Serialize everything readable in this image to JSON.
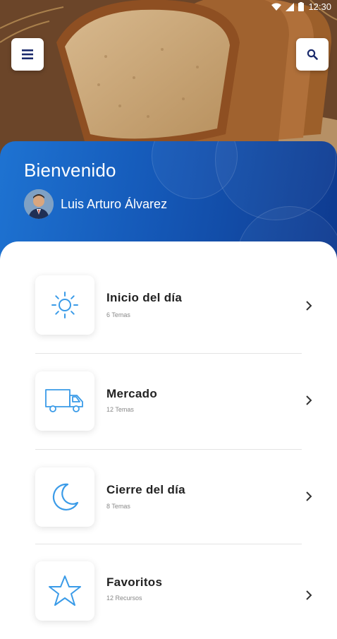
{
  "status_bar": {
    "time": "12:30"
  },
  "header": {
    "menu_icon": "hamburger-menu-icon",
    "search_icon": "search-icon",
    "welcome": "Bienvenido",
    "user_name": "Luis Arturo Álvarez"
  },
  "colors": {
    "accent_blue": "#1559b8",
    "dark_blue": "#0e3a8f",
    "icon_blue": "#3a9be8",
    "navy": "#1a2a6c"
  },
  "menu": {
    "items": [
      {
        "title": "Inicio del día",
        "subtitle": "6 Temas",
        "icon": "sun-icon"
      },
      {
        "title": "Mercado",
        "subtitle": "12 Temas",
        "icon": "truck-icon"
      },
      {
        "title": "Cierre del día",
        "subtitle": "8 Temas",
        "icon": "moon-icon"
      },
      {
        "title": "Favoritos",
        "subtitle": "12 Recursos",
        "icon": "star-icon"
      }
    ]
  }
}
